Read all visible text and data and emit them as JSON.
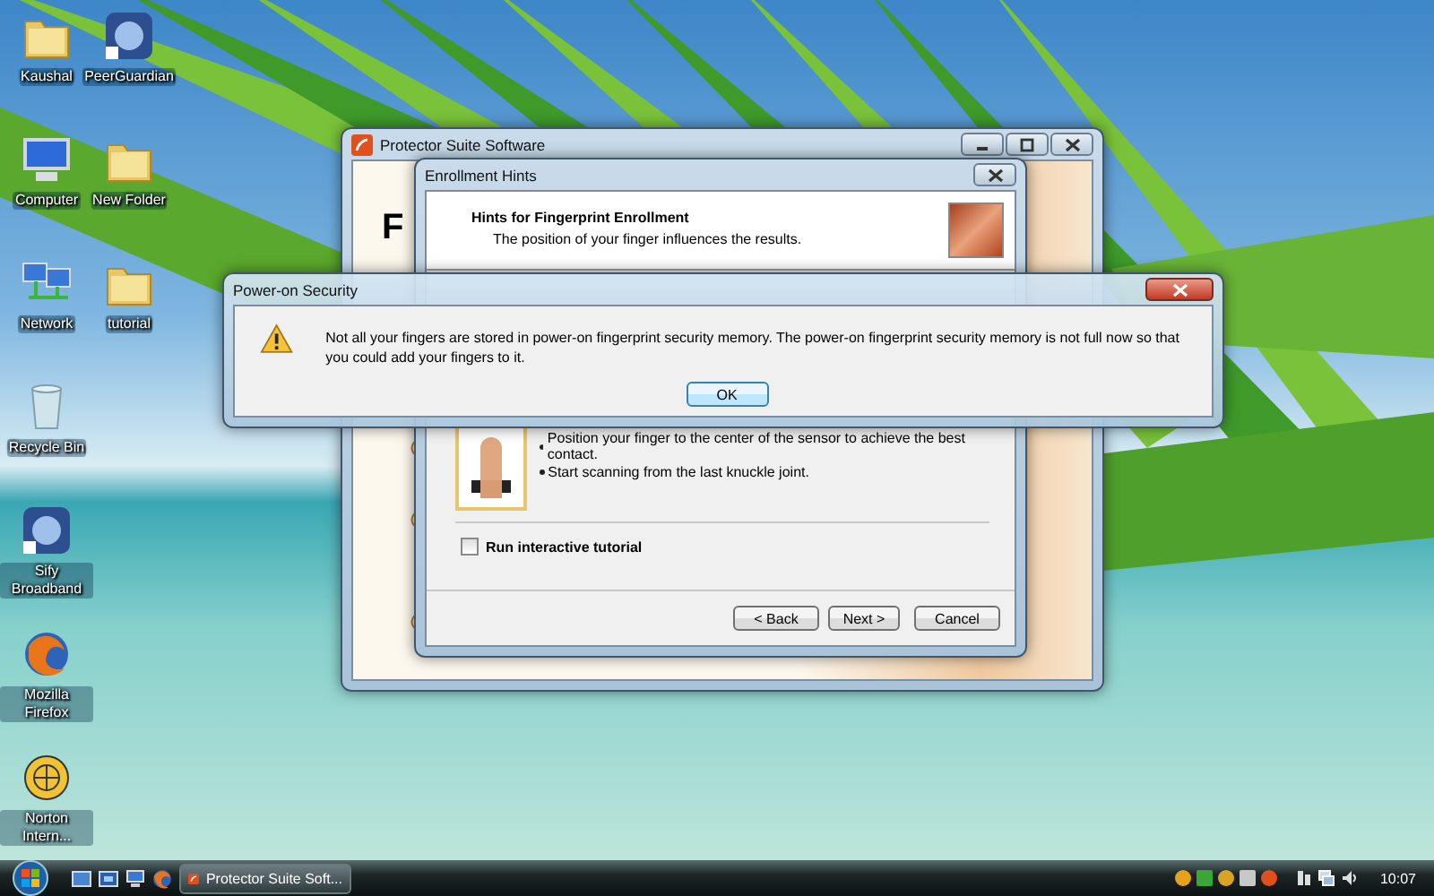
{
  "desktop_icons": [
    {
      "label": "Kaushal",
      "kind": "folder"
    },
    {
      "label": "PeerGuardian",
      "kind": "app"
    },
    {
      "label": "Computer",
      "kind": "computer"
    },
    {
      "label": "New Folder",
      "kind": "folder"
    },
    {
      "label": "Network",
      "kind": "network"
    },
    {
      "label": "tutorial",
      "kind": "folder"
    },
    {
      "label": "Recycle Bin",
      "kind": "bin"
    },
    {
      "label": "Sify Broadband",
      "kind": "app"
    },
    {
      "label": "Mozilla Firefox",
      "kind": "browser"
    },
    {
      "label": "Norton Intern...",
      "kind": "globe"
    }
  ],
  "protector_window": {
    "title": "Protector Suite Software",
    "heading_fragment": "F"
  },
  "enrollment_dialog": {
    "title": "Enrollment Hints",
    "header_title": "Hints for Fingerprint Enrollment",
    "header_subtitle": "The position of your finger influences the results.",
    "bullets": [
      "Position your finger to the center of the sensor to achieve the best contact.",
      "Start scanning from the last knuckle joint."
    ],
    "checkbox": {
      "label": "Run interactive tutorial",
      "checked": false
    },
    "buttons": [
      "< Back",
      "Next >",
      "Cancel"
    ]
  },
  "alert": {
    "title": "Power-on Security",
    "message": "Not all your fingers are stored in power-on fingerprint security memory. The power-on fingerprint security memory is not full now so that you could add your fingers to it.",
    "button": "OK"
  },
  "taskbar": {
    "tasks": [
      {
        "label": "Protector Suite Soft...",
        "selected": true
      }
    ],
    "clock": "10:07"
  }
}
